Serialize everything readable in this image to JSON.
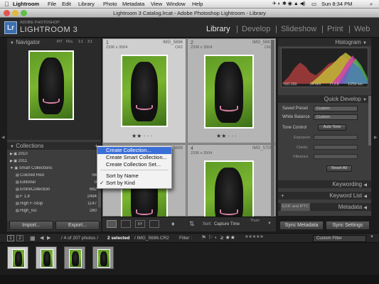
{
  "menubar": {
    "apple": "",
    "items": [
      "Lightroom",
      "File",
      "Edit",
      "Library",
      "Photo",
      "Metadata",
      "View",
      "Window",
      "Help"
    ],
    "clock": "Sun 8:34 PM"
  },
  "window": {
    "title": "Lightroom 3 Catalog.lrcat - Adobe Photoshop Lightroom - Library"
  },
  "identity": {
    "badge": "Lr",
    "brand_small": "ADOBE PHOTOSHOP",
    "brand_large": "LIGHTROOM 3",
    "modules": [
      "Library",
      "Develop",
      "Slideshow",
      "Print",
      "Web"
    ],
    "separator": "|"
  },
  "navigator": {
    "title": "Navigator",
    "zoom_options": [
      "FIT",
      "FILL",
      "1:1",
      "3:1"
    ]
  },
  "collections": {
    "title": "Collections",
    "add": "+",
    "items": [
      {
        "name": "2010",
        "count": ""
      },
      {
        "name": "2011",
        "count": ""
      },
      {
        "name": "Smart Collections",
        "count": ""
      },
      {
        "name": "Colored Red",
        "count": "56"
      },
      {
        "name": "Editorial",
        "count": "0"
      },
      {
        "name": "EntireCollection",
        "count": "682"
      },
      {
        "name": "F 1.8",
        "count": "2494"
      },
      {
        "name": "High F-Stop",
        "count": "1147"
      },
      {
        "name": "High_iso",
        "count": "280"
      }
    ]
  },
  "left_buttons": {
    "import": "Import...",
    "export": "Export..."
  },
  "grid": {
    "cells": [
      {
        "index": "1",
        "filename": "IMG_5696",
        "dims": "2336 x 3504",
        "type": "CR2",
        "stars": "★★ · · ·"
      },
      {
        "index": "2",
        "filename": "IMG_5697",
        "dims": "2336 x 3504",
        "type": "CR2",
        "stars": "★★ · · ·"
      },
      {
        "index": "3",
        "filename": "IMG_5698",
        "dims": "",
        "type": "",
        "stars": ""
      },
      {
        "index": "4",
        "filename": "IMG_5700",
        "dims": "2336 x 3504",
        "type": "",
        "stars": ""
      }
    ]
  },
  "context_menu": {
    "items": [
      {
        "label": "Create Collection...",
        "checked": "",
        "highlighted": true
      },
      {
        "label": "Create Smart Collection...",
        "checked": "",
        "highlighted": false
      },
      {
        "label": "Create Collection Set...",
        "checked": "",
        "highlighted": false
      },
      {
        "label": "Sort by Name",
        "checked": "",
        "highlighted": false
      },
      {
        "label": "Sort by Kind",
        "checked": "✓",
        "highlighted": false
      }
    ]
  },
  "toolbar": {
    "sort_label": "Sort:",
    "sort_value": "Capture Time",
    "thumbnails": "Thum"
  },
  "histogram": {
    "title": "Histogram",
    "iso": "ISO 250",
    "focal": "24 mm",
    "aperture": "f / 2.8",
    "shutter": "1/250 sec"
  },
  "quick_develop": {
    "title": "Quick Develop",
    "saved_preset_label": "Saved Preset",
    "saved_preset_value": "Custom",
    "white_balance_label": "White Balance",
    "white_balance_value": "Custom",
    "tone_control_label": "Tone Control",
    "auto_tone": "Auto Tone",
    "exposure": "Exposure",
    "clarity": "Clarity",
    "vibrance": "Vibrance",
    "reset_all": "Reset All"
  },
  "right_panels": {
    "keywording": "Keywording",
    "keyword_list": "Keyword List",
    "exif": "EXIF and IPTC",
    "metadata": "Metadata",
    "add": "+"
  },
  "right_buttons": {
    "sync_metadata": "Sync Metadata",
    "sync_settings": "Sync Settings"
  },
  "filmstrip_bar": {
    "views": [
      "1",
      "2"
    ],
    "grid_label": "",
    "source": "/ 4 of 207 photos /",
    "selected": "2 selected",
    "file": "/ IMG_5696.CR2",
    "filter_label": "Filter :",
    "stars": "★★",
    "custom_filter": "Custom Filter"
  },
  "colors": {
    "accent": "#3b6fd8",
    "panel": "#3d3d3d",
    "grid_bg": "#b5b5b5"
  }
}
